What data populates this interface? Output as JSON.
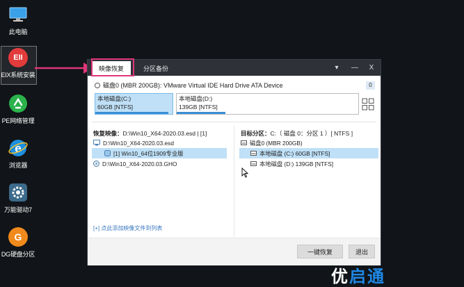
{
  "desktop": {
    "icons": [
      {
        "label": "此电脑",
        "icon": "computer-icon"
      },
      {
        "label": "EIX系统安装",
        "icon": "eix-app-icon",
        "logo_text": "EII"
      },
      {
        "label": "PE网络管理",
        "icon": "pe-network-icon"
      },
      {
        "label": "浏览器",
        "icon": "browser-icon"
      },
      {
        "label": "万能驱动7",
        "icon": "driver-gear-icon"
      },
      {
        "label": "DG硬盘分区",
        "icon": "dg-partition-icon",
        "logo_text": "G"
      }
    ]
  },
  "window": {
    "tabs": [
      {
        "label": "映像恢复",
        "active": true
      },
      {
        "label": "分区备份",
        "active": false
      }
    ],
    "controls": {
      "menu": "▾",
      "minimize": "—",
      "close": "X"
    },
    "disk": {
      "label": "磁盘0 (MBR 200GB): VMware Virtual IDE Hard Drive ATA Device",
      "count": "0"
    },
    "partitions": [
      {
        "name": "本地磁盘(C:)",
        "info": "60GB [NTFS]",
        "used": 0.95,
        "selected": true
      },
      {
        "name": "本地磁盘(D:)",
        "info": "139GB [NTFS]",
        "used": 0.27,
        "selected": false
      }
    ],
    "restore_image": {
      "label": "恢复映像：",
      "value": "D:\\Win10_X64-2020.03.esd | [1]",
      "items": [
        {
          "text": "D:\\Win10_X64-2020.03.esd",
          "level": 0,
          "selected": false
        },
        {
          "text": "[1] Win10_64位1909专业版",
          "level": 1,
          "selected": true
        },
        {
          "text": "D:\\Win10_X64-2020.03.GHO",
          "level": 0,
          "selected": false
        }
      ]
    },
    "target_partition": {
      "label": "目标分区：",
      "value": "C:（ 磁盘 0：分区 1 ）[ NTFS ]",
      "items": [
        {
          "text": "磁盘0 (MBR 200GB)",
          "level": 0,
          "selected": false
        },
        {
          "text": "本地磁盘 (C:) 60GB [NTFS]",
          "level": 1,
          "selected": true
        },
        {
          "text": "本地磁盘 (D:) 139GB [NTFS]",
          "level": 1,
          "selected": false
        }
      ]
    },
    "add_link": "[+] 点此添加映像文件到列表",
    "buttons": {
      "restore": "一键恢复",
      "exit": "退出"
    }
  },
  "watermark": {
    "part1": "优",
    "part2": "启通"
  },
  "colors": {
    "accent": "#e0357a",
    "selection": "#bfe0f7",
    "bar": "#3a8fd6",
    "titlebar": "#2e3238"
  }
}
